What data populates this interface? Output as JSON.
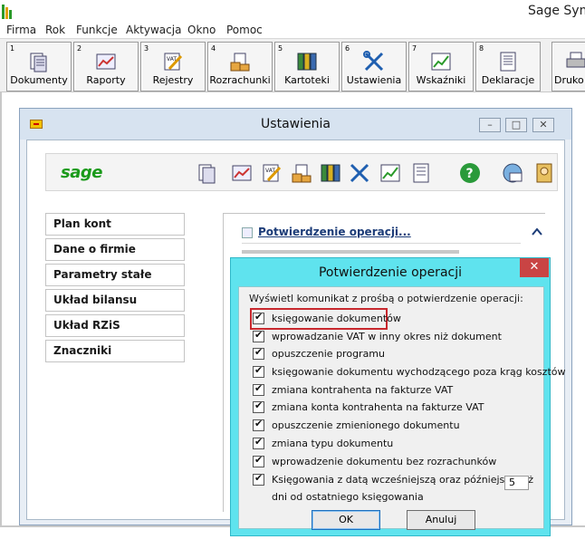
{
  "app": {
    "title": "Sage Sym"
  },
  "menu": [
    "Firma",
    "Rok",
    "Funkcje",
    "Aktywacja",
    "Okno",
    "Pomoc"
  ],
  "toolbar": [
    {
      "num": "1",
      "label": "Dokumenty",
      "icon": "documents-icon"
    },
    {
      "num": "2",
      "label": "Raporty",
      "icon": "reports-icon"
    },
    {
      "num": "3",
      "label": "Rejestry",
      "icon": "vat-registers-icon"
    },
    {
      "num": "4",
      "label": "Rozrachunki",
      "icon": "settlements-icon"
    },
    {
      "num": "5",
      "label": "Kartoteki",
      "icon": "binders-icon"
    },
    {
      "num": "6",
      "label": "Ustawienia",
      "icon": "tools-icon"
    },
    {
      "num": "7",
      "label": "Wskaźniki",
      "icon": "chart-icon"
    },
    {
      "num": "8",
      "label": "Deklaracje",
      "icon": "declarations-icon"
    },
    {
      "num": "",
      "label": "Druko",
      "icon": "printer-icon"
    }
  ],
  "settings_window": {
    "title": "Ustawienia",
    "nav": [
      "Plan kont",
      "Dane o firmie",
      "Parametry stałe",
      "Układ bilansu",
      "Układ RZiS",
      "Znaczniki"
    ],
    "link": "Potwierdzenie operacji..."
  },
  "dialog": {
    "title": "Potwierdzenie operacji",
    "prompt": "Wyświetl komunikat z prośbą o potwierdzenie operacji:",
    "options": [
      "księgowanie dokumentów",
      "wprowadzanie VAT w inny okres niż dokument",
      "opuszczenie programu",
      "księgowanie dokumentu wychodzącego poza krąg kosztów",
      "zmiana kontrahenta na fakturze VAT",
      "zmiana konta kontrahenta na fakturze VAT",
      "opuszczenie zmienionego dokumentu",
      "zmiana typu dokumentu",
      "wprowadzenie dokumentu bez rozrachunków",
      "Księgowania z datą wcześniejszą oraz późniejszą niż"
    ],
    "days_value": "5",
    "days_suffix": "dni od ostatniego księgowania",
    "ok_label": "OK",
    "cancel_label": "Anuluj"
  }
}
